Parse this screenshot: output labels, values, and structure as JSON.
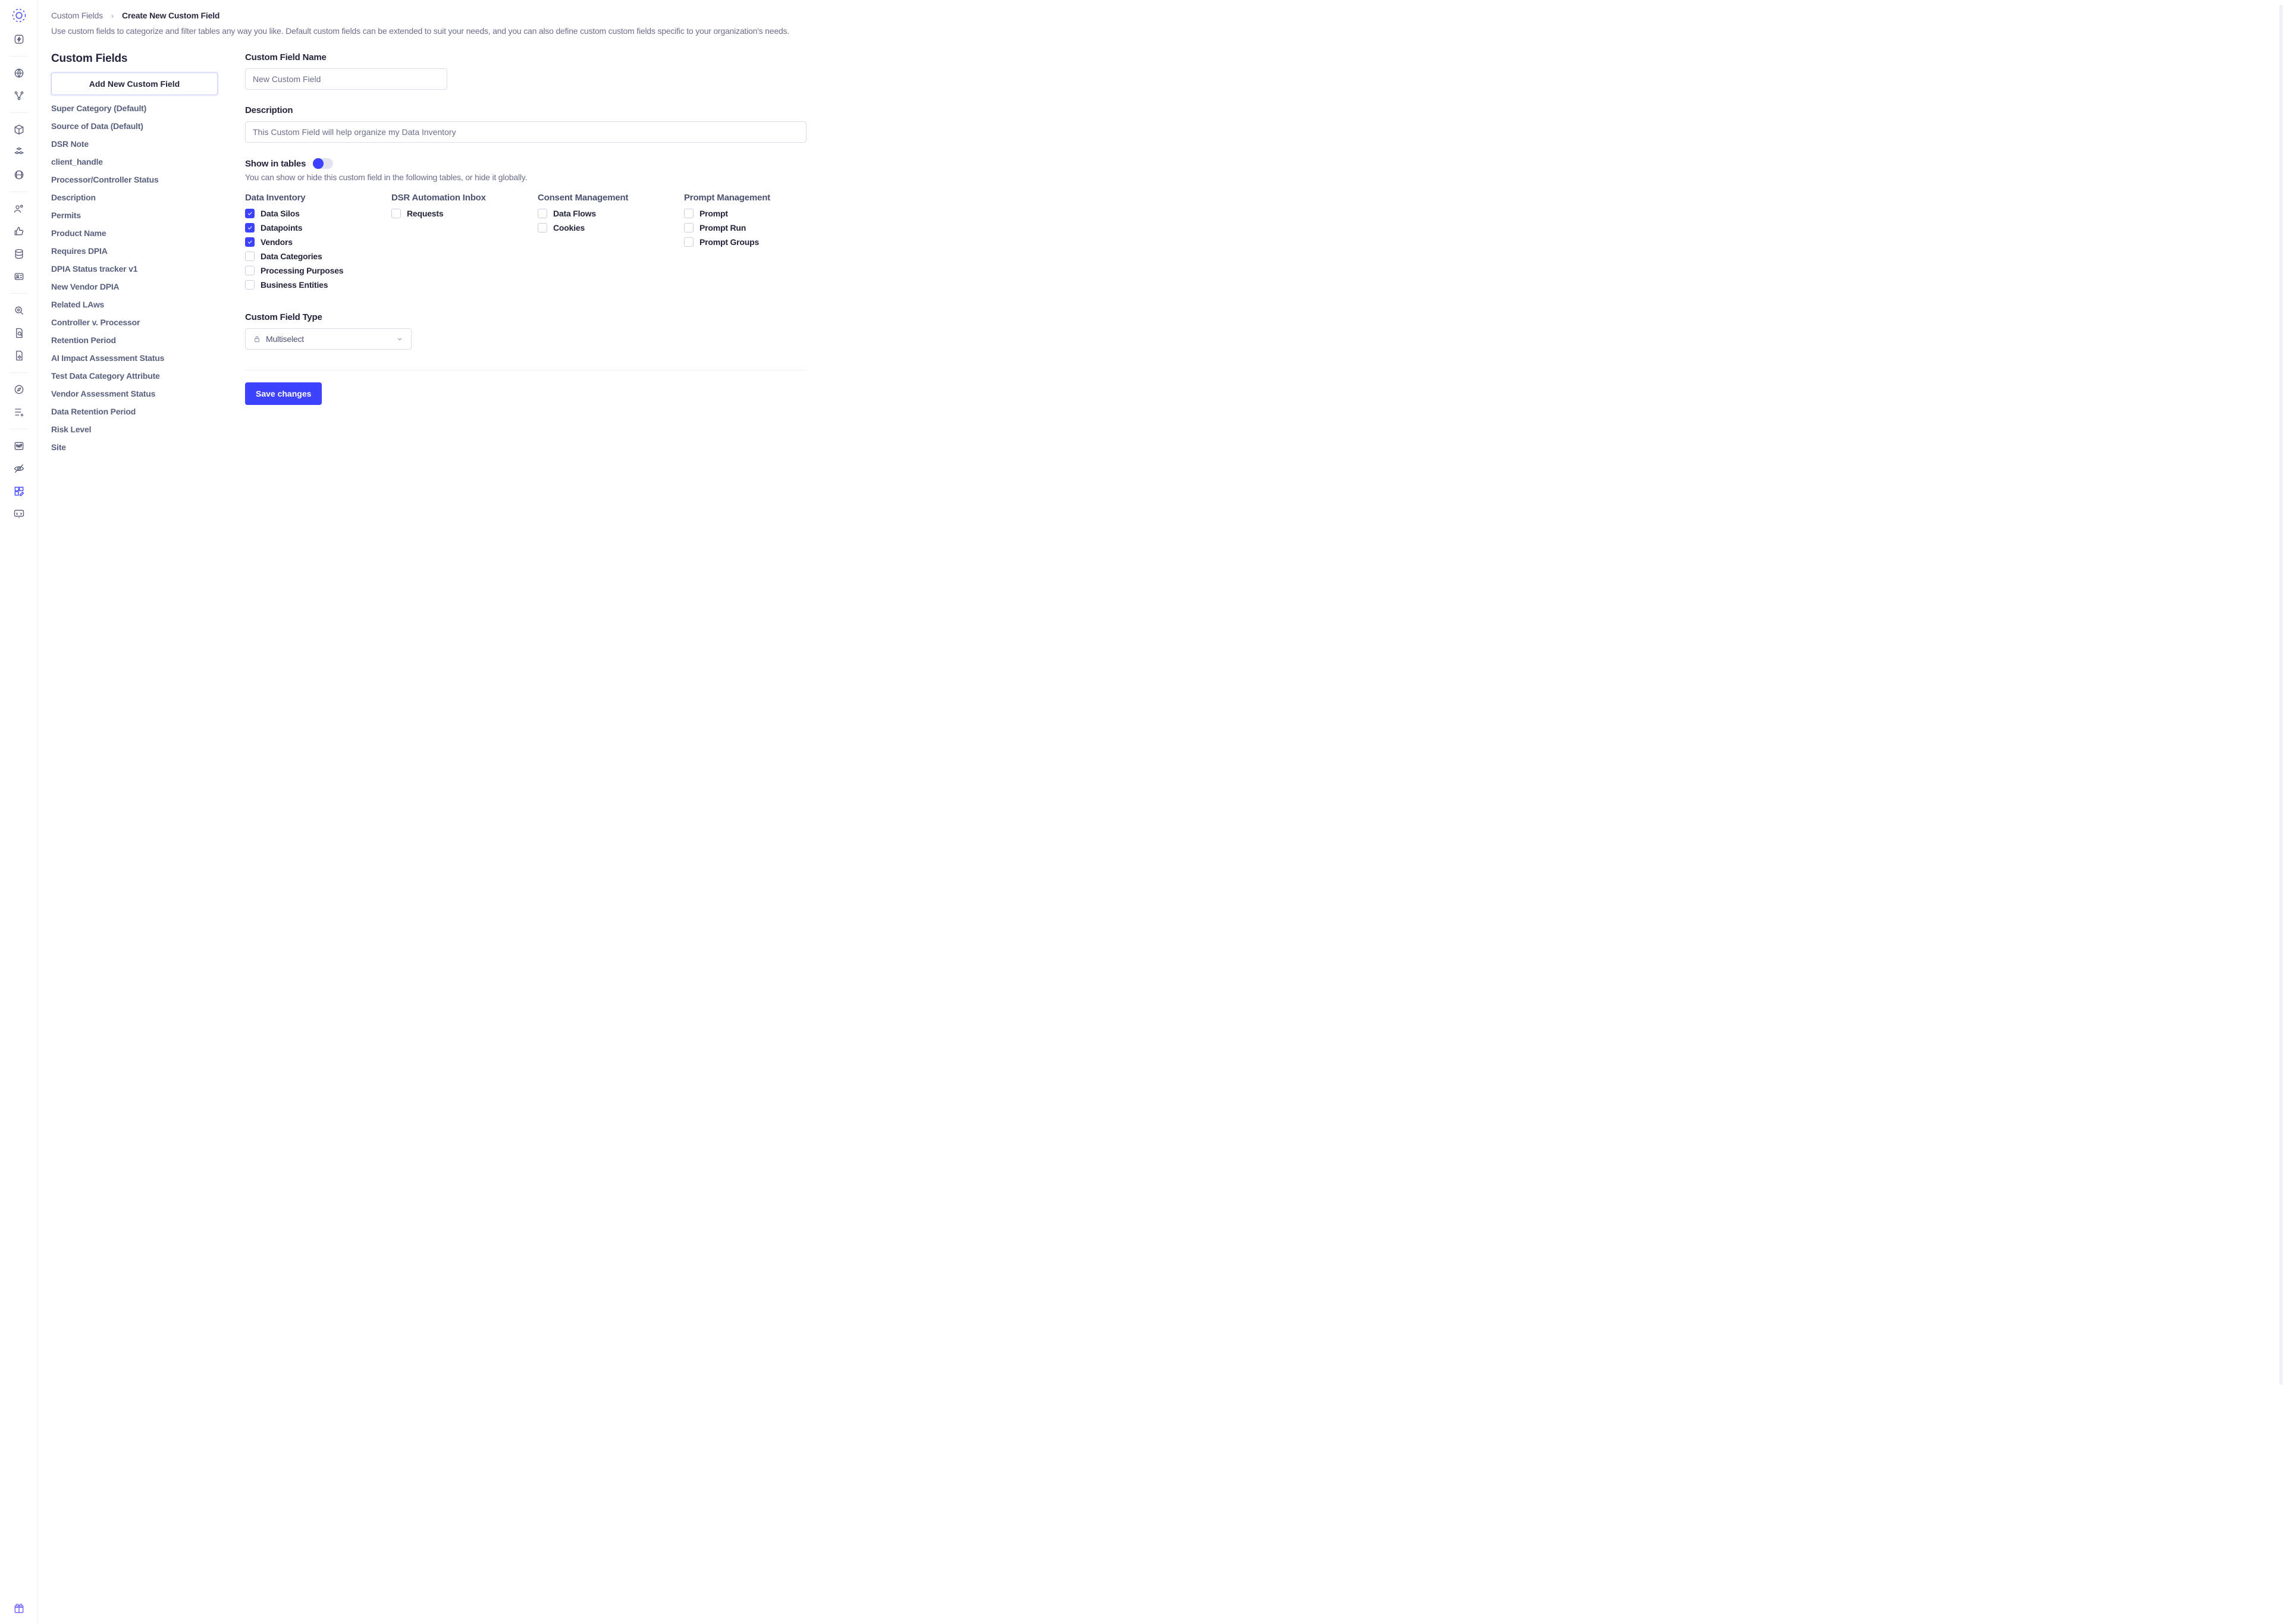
{
  "breadcrumb": {
    "root": "Custom Fields",
    "current": "Create New Custom Field"
  },
  "page_description": "Use custom fields to categorize and filter tables any way you like. Default custom fields can be extended to suit your needs, and you can also define custom custom fields specific to your organization's needs.",
  "left": {
    "heading": "Custom Fields",
    "add_button_label": "Add New Custom Field",
    "items": [
      "Super Category (Default)",
      "Source of Data (Default)",
      "DSR Note",
      "client_handle",
      "Processor/Controller Status",
      "Description",
      "Permits",
      "Product Name",
      "Requires DPIA",
      "DPIA Status tracker v1",
      "New Vendor DPIA",
      "Related LAws",
      "Controller v. Processor",
      "Retention Period",
      "AI Impact Assessment Status",
      "Test Data Category Attribute",
      "Vendor Assessment Status",
      "Data Retention Period",
      "Risk Level",
      "Site"
    ]
  },
  "form": {
    "name_label": "Custom Field Name",
    "name_value": "New Custom Field",
    "desc_label": "Description",
    "desc_value": "This Custom Field will help organize my Data Inventory",
    "show_in_tables_label": "Show in tables",
    "show_in_tables_help": "You can show or hide this custom field in the following tables, or hide it globally.",
    "tables": {
      "data_inventory": {
        "title": "Data Inventory",
        "options": [
          {
            "label": "Data Silos",
            "checked": true
          },
          {
            "label": "Datapoints",
            "checked": true
          },
          {
            "label": "Vendors",
            "checked": true
          },
          {
            "label": "Data Categories",
            "checked": false
          },
          {
            "label": "Processing Purposes",
            "checked": false
          },
          {
            "label": "Business Entities",
            "checked": false
          }
        ]
      },
      "dsr_automation": {
        "title": "DSR Automation Inbox",
        "options": [
          {
            "label": "Requests",
            "checked": false
          }
        ]
      },
      "consent": {
        "title": "Consent Management",
        "options": [
          {
            "label": "Data Flows",
            "checked": false
          },
          {
            "label": "Cookies",
            "checked": false
          }
        ]
      },
      "prompt": {
        "title": "Prompt Management",
        "options": [
          {
            "label": "Prompt",
            "checked": false
          },
          {
            "label": "Prompt Run",
            "checked": false
          },
          {
            "label": "Prompt Groups",
            "checked": false
          }
        ]
      }
    },
    "type_label": "Custom Field Type",
    "type_value": "Multiselect",
    "save_label": "Save changes"
  },
  "rail_icons": [
    "bolt-icon",
    "globe-icon",
    "nodes-icon",
    "cube-icon",
    "cubes-icon",
    "web-icon",
    "users-icon",
    "thumbs-up-icon",
    "database-icon",
    "id-card-icon",
    "search-doc-icon",
    "file-search-icon",
    "file-gear-icon",
    "compass-icon",
    "list-plus-icon",
    "sliders-icon",
    "eye-off-icon",
    "grid-edit-icon",
    "code-screen-icon"
  ]
}
